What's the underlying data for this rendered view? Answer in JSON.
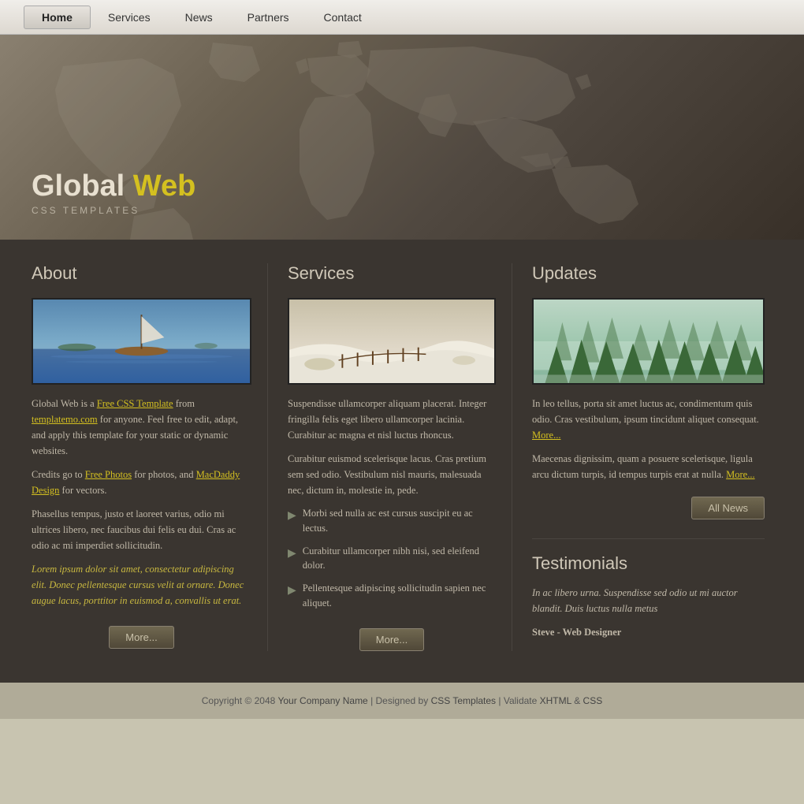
{
  "nav": {
    "items": [
      {
        "label": "Home",
        "active": true
      },
      {
        "label": "Services",
        "active": false
      },
      {
        "label": "News",
        "active": false
      },
      {
        "label": "Partners",
        "active": false
      },
      {
        "label": "Contact",
        "active": false
      }
    ]
  },
  "hero": {
    "title_plain": "Global ",
    "title_yellow": "Web",
    "subtitle": "CSS Templates"
  },
  "about": {
    "heading": "About",
    "p1_pre": "Global Web is a ",
    "p1_link1": "Free CSS Template",
    "p1_mid": " from ",
    "p1_link2": "templatemo.com",
    "p1_post": " for anyone. Feel free to edit, adapt, and apply this template for your static or dynamic websites.",
    "p2_pre": "Credits go to ",
    "p2_link1": "Free Photos",
    "p2_mid": " for photos, and ",
    "p2_link2": "MacDaddy Design",
    "p2_post": " for vectors.",
    "p3": "Phasellus tempus, justo et laoreet varius, odio mi ultrices libero, nec faucibus dui felis eu dui. Cras ac odio ac mi imperdiet sollicitudin.",
    "p4": "Lorem ipsum dolor sit amet, consectetur adipiscing elit. Donec pellentesque cursus velit at ornare. Donec augue lacus, porttitor in euismod a, convallis ut erat.",
    "more_btn": "More..."
  },
  "services": {
    "heading": "Services",
    "p1": "Suspendisse ullamcorper aliquam placerat. Integer fringilla felis eget libero ullamcorper lacinia. Curabitur ac magna et nisl luctus rhoncus.",
    "p2": "Curabitur euismod scelerisque lacus. Cras pretium sem sed odio. Vestibulum nisl mauris, malesuada nec, dictum in, molestie in, pede.",
    "bullets": [
      "Morbi sed nulla ac est cursus suscipit eu ac lectus.",
      "Curabitur ullamcorper nibh nisi, sed eleifend dolor.",
      "Pellentesque adipiscing sollicitudin sapien nec aliquet."
    ],
    "more_btn": "More..."
  },
  "updates": {
    "heading": "Updates",
    "p1": "In leo tellus, porta sit amet luctus ac, condimentum quis odio. Cras vestibulum, ipsum tincidunt aliquet consequat.",
    "p1_more": "More...",
    "p2": "Maecenas dignissim, quam a posuere scelerisque, ligula arcu dictum turpis, id tempus turpis erat at nulla.",
    "p2_more": "More...",
    "all_news_btn": "All News"
  },
  "testimonials": {
    "heading": "Testimonials",
    "quote": "In ac libero urna. Suspendisse sed odio ut mi auctor blandit. Duis luctus nulla metus",
    "author": "Steve - Web Designer"
  },
  "footer": {
    "copyright": "Copyright © 2048 ",
    "company_link": "Your Company Name",
    "designed_by": " | Designed by ",
    "css_link": "CSS Templates",
    "validate": " | Validate ",
    "xhtml_link": "XHTML",
    "amp": " & ",
    "css_link2": "CSS"
  }
}
